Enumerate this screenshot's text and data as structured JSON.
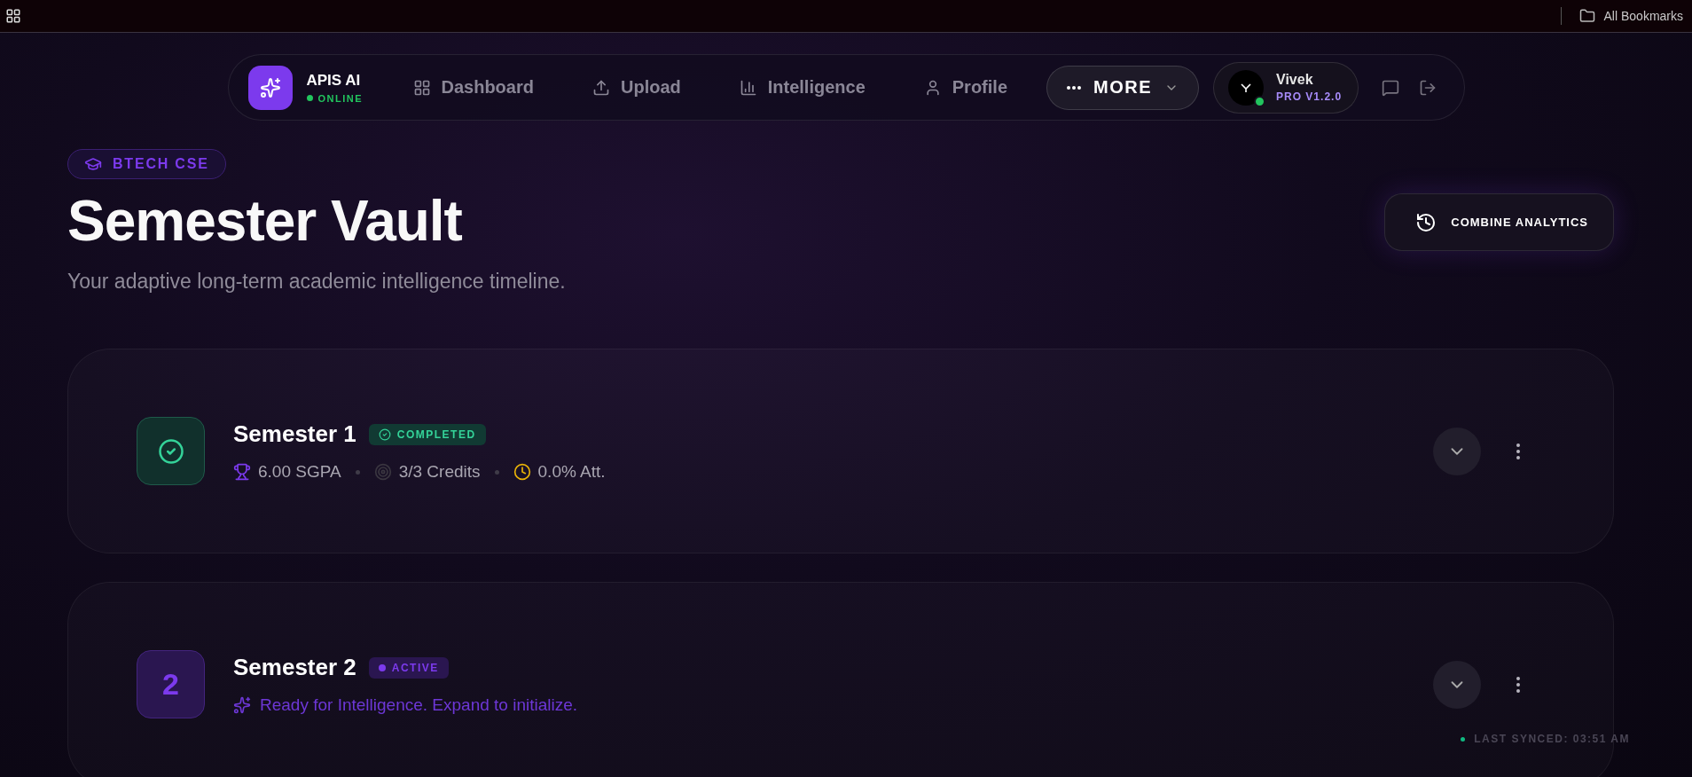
{
  "browser_bar": {
    "bookmarks": "All Bookmarks"
  },
  "nav": {
    "brand": {
      "name": "APIS AI",
      "status": "ONLINE",
      "online": true
    },
    "links": [
      {
        "label": "Dashboard"
      },
      {
        "label": "Upload"
      },
      {
        "label": "Intelligence"
      },
      {
        "label": "Profile"
      }
    ],
    "more": "MORE",
    "user": {
      "name": "Vivek",
      "plan": "PRO V1.2.0",
      "online": true
    }
  },
  "header": {
    "badge": "BTECH CSE",
    "title": "Semester Vault",
    "subtitle": "Your adaptive long-term academic intelligence timeline.",
    "action": "COMBINE ANALYTICS"
  },
  "semesters": [
    {
      "kind": "completed",
      "title": "Semester 1",
      "status": "COMPLETED",
      "expanded": false,
      "stats": [
        {
          "kind": "sgpa",
          "text": "6.00 SGPA"
        },
        {
          "kind": "credits",
          "text": "3/3 Credits"
        },
        {
          "kind": "attendance",
          "text": "0.0% Att."
        }
      ]
    },
    {
      "kind": "active",
      "number": "2",
      "title": "Semester 2",
      "status": "ACTIVE",
      "expanded": false,
      "message": "Ready for Intelligence. Expand to initialize."
    }
  ],
  "sync": {
    "text": "LAST SYNCED: 03:51 AM",
    "online": true
  }
}
